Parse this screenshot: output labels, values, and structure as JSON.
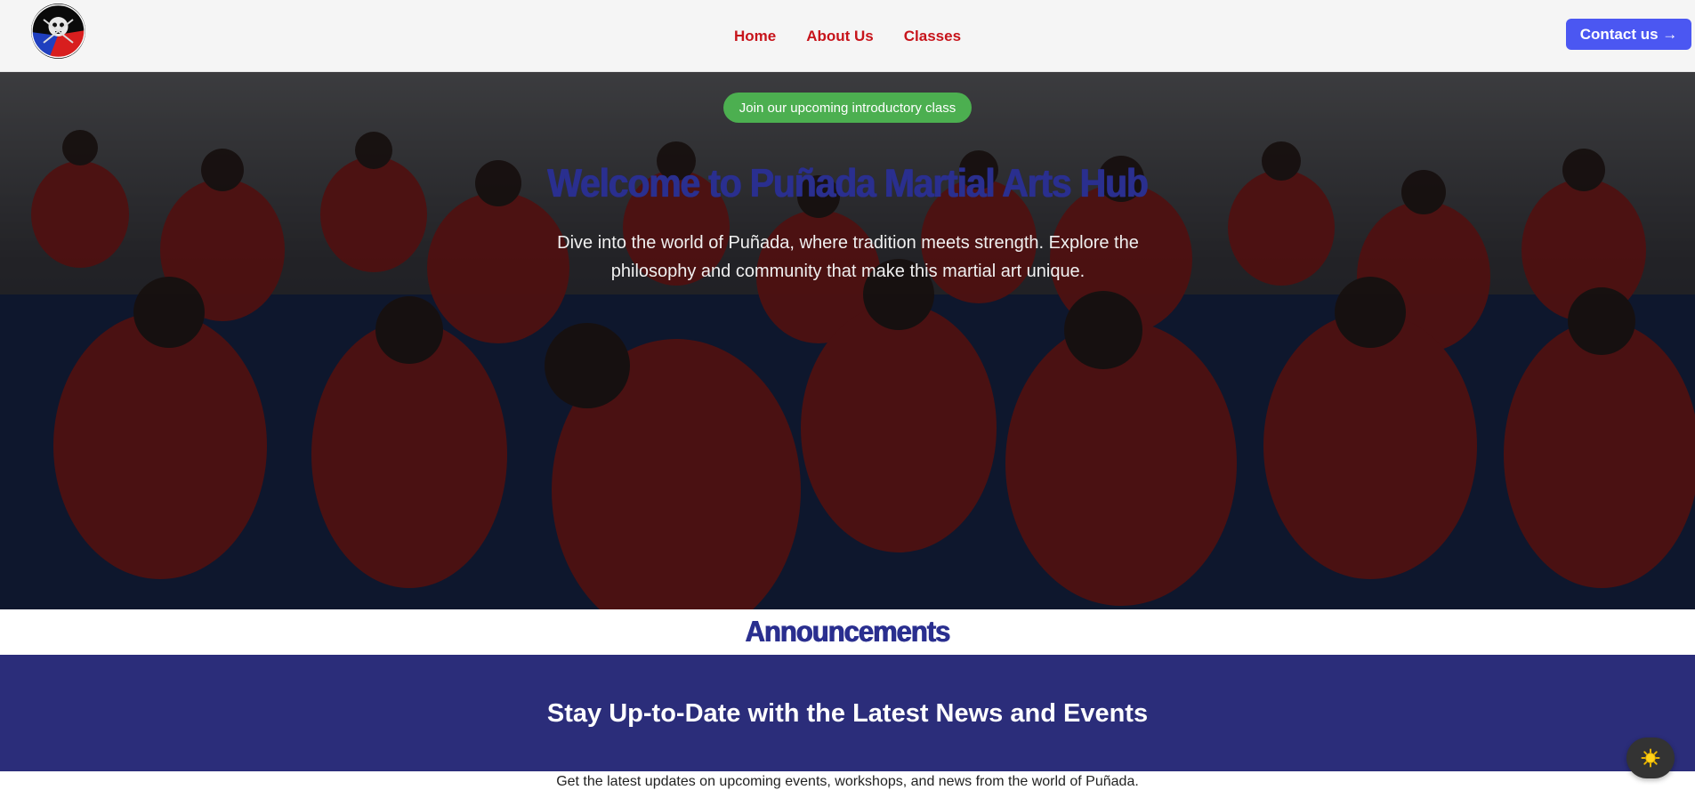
{
  "header": {
    "logo_alt": "Puñada Tactical Group logo",
    "nav": [
      {
        "label": "Home"
      },
      {
        "label": "About Us"
      },
      {
        "label": "Classes"
      }
    ],
    "contact_label": "Contact us →"
  },
  "hero": {
    "intro_pill": "Join our upcoming introductory class",
    "title": "Welcome to Puñada Martial Arts Hub",
    "subtitle": "Dive into the world of Puñada, where tradition meets strength. Explore the philosophy and community that make this martial art unique."
  },
  "announcements": {
    "title": "Announcements",
    "news_title": "Stay Up-to-Date with the Latest News and Events",
    "news_desc": "Get the latest updates on upcoming events, workshops, and news from the world of Puñada."
  },
  "colors": {
    "nav_red": "#c7141b",
    "contact_blue": "#4b57f2",
    "pill_green": "#4caf50",
    "brand_navy": "#2a2f8f",
    "band_navy": "#2b2d7a"
  },
  "icons": {
    "theme_toggle": "sun-icon"
  }
}
